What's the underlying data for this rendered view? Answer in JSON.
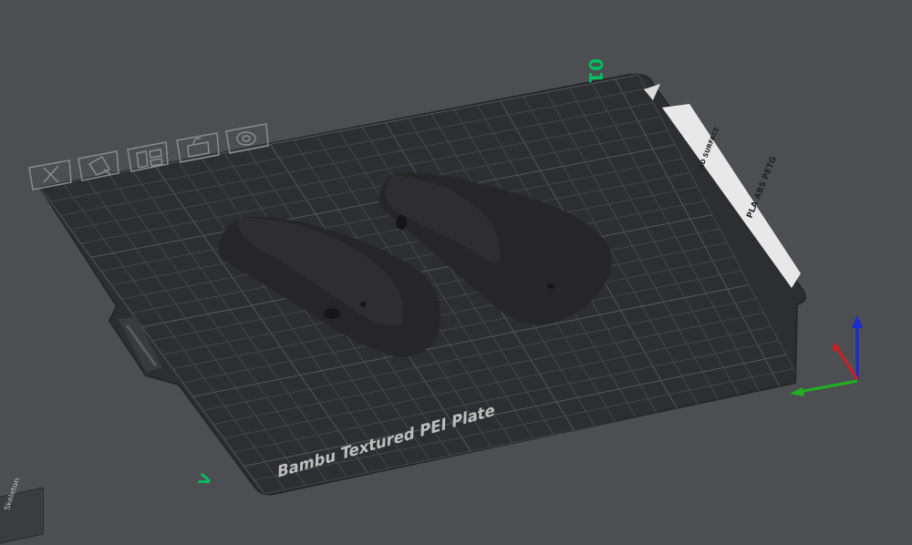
{
  "plate": {
    "label": "Bambu Textured PEI Plate",
    "index_label": "01",
    "sticker_lines": [
      "PLA ABS PETG",
      "AD SURFACE"
    ]
  },
  "axis_indicator": {
    "x_color": "#cc2020",
    "y_color": "#20b020",
    "z_color": "#1a2bd1"
  },
  "corner_marker": {
    "label": "V"
  },
  "view_cube": {
    "face_label": "Skeleton"
  },
  "plate_toolbar": {
    "buttons": [
      {
        "name": "remove-plate",
        "icon": "close-icon"
      },
      {
        "name": "auto-orient",
        "icon": "orient-icon"
      },
      {
        "name": "arrange",
        "icon": "arrange-icon"
      },
      {
        "name": "lock-plate",
        "icon": "lock-icon"
      },
      {
        "name": "plate-settings",
        "icon": "gear-icon"
      }
    ]
  },
  "colors": {
    "background": "#4d4e52",
    "plate": "#2d2e31",
    "grid": "#4a4b50",
    "model": "#262628",
    "accent": "#00c060"
  }
}
